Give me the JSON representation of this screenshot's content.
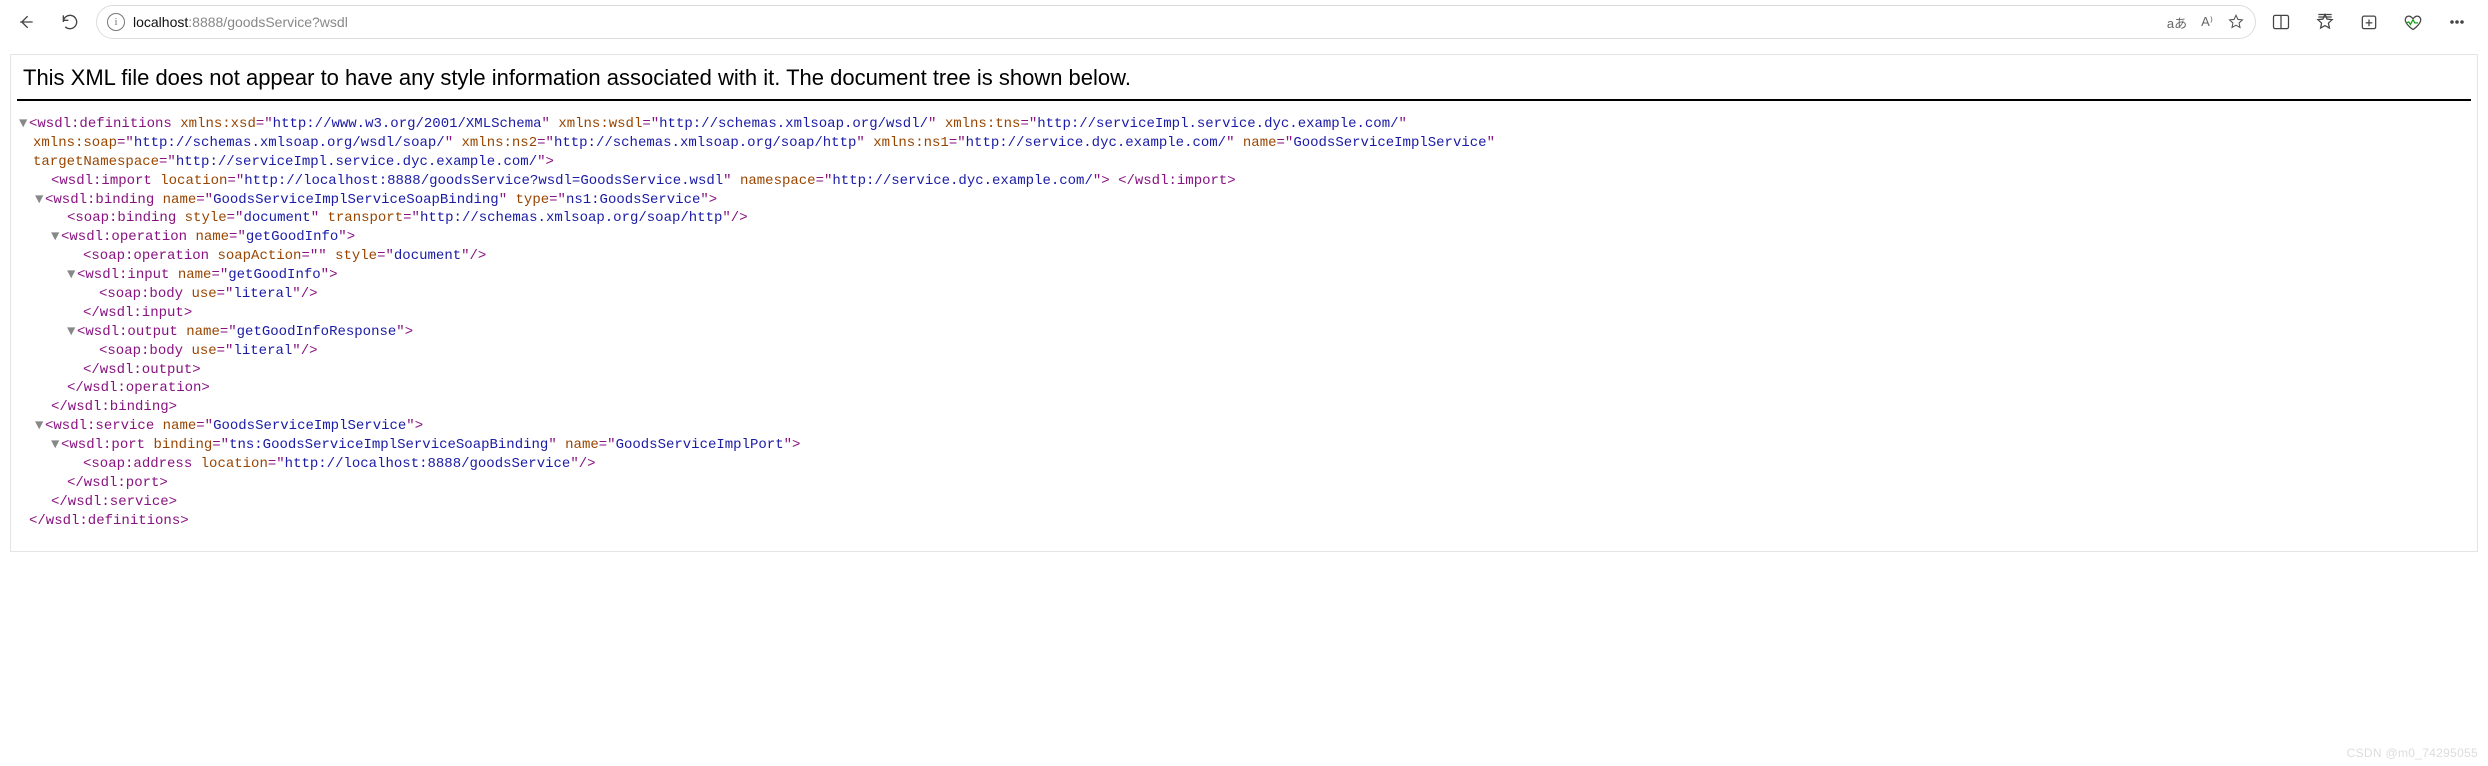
{
  "toolbar": {
    "back_title": "Back",
    "refresh_title": "Refresh"
  },
  "address": {
    "host": "localhost",
    "rest": ":8888/goodsService?wsdl",
    "translate_label": "aあ",
    "readaloud_label": "A⁾"
  },
  "banner": "This XML file does not appear to have any style information associated with it. The document tree is shown below.",
  "watermark": "CSDN @m0_74295055",
  "xml": {
    "definitions": {
      "tag_open": "wsdl:definitions",
      "attrs": [
        {
          "n": "xmlns:xsd",
          "v": "http://www.w3.org/2001/XMLSchema"
        },
        {
          "n": "xmlns:wsdl",
          "v": "http://schemas.xmlsoap.org/wsdl/"
        },
        {
          "n": "xmlns:tns",
          "v": "http://serviceImpl.service.dyc.example.com/"
        },
        {
          "n": "xmlns:soap",
          "v": "http://schemas.xmlsoap.org/wsdl/soap/"
        },
        {
          "n": "xmlns:ns2",
          "v": "http://schemas.xmlsoap.org/soap/http"
        },
        {
          "n": "xmlns:ns1",
          "v": "http://service.dyc.example.com/"
        },
        {
          "n": "name",
          "v": "GoodsServiceImplService"
        },
        {
          "n": "targetNamespace",
          "v": "http://serviceImpl.service.dyc.example.com/"
        }
      ],
      "import": {
        "tag": "wsdl:import",
        "location_n": "location",
        "location_v": "http://localhost:8888/goodsService?wsdl=GoodsService.wsdl",
        "namespace_n": "namespace",
        "namespace_v": "http://service.dyc.example.com/",
        "close": "</wsdl:import>"
      },
      "binding": {
        "tag": "wsdl:binding",
        "name_n": "name",
        "name_v": "GoodsServiceImplServiceSoapBinding",
        "type_n": "type",
        "type_v": "ns1:GoodsService",
        "soap_binding": {
          "tag": "soap:binding",
          "style_n": "style",
          "style_v": "document",
          "transport_n": "transport",
          "transport_v": "http://schemas.xmlsoap.org/soap/http"
        },
        "operation": {
          "tag": "wsdl:operation",
          "name_n": "name",
          "name_v": "getGoodInfo",
          "soap_operation": {
            "tag": "soap:operation",
            "soapAction_n": "soapAction",
            "soapAction_v": "",
            "style_n": "style",
            "style_v": "document"
          },
          "input": {
            "tag": "wsdl:input",
            "name_n": "name",
            "name_v": "getGoodInfo",
            "body": {
              "tag": "soap:body",
              "use_n": "use",
              "use_v": "literal"
            },
            "close": "</wsdl:input>"
          },
          "output": {
            "tag": "wsdl:output",
            "name_n": "name",
            "name_v": "getGoodInfoResponse",
            "body": {
              "tag": "soap:body",
              "use_n": "use",
              "use_v": "literal"
            },
            "close": "</wsdl:output>"
          },
          "close": "</wsdl:operation>"
        },
        "close": "</wsdl:binding>"
      },
      "service": {
        "tag": "wsdl:service",
        "name_n": "name",
        "name_v": "GoodsServiceImplService",
        "port": {
          "tag": "wsdl:port",
          "binding_n": "binding",
          "binding_v": "tns:GoodsServiceImplServiceSoapBinding",
          "name_n": "name",
          "name_v": "GoodsServiceImplPort",
          "address": {
            "tag": "soap:address",
            "location_n": "location",
            "location_v": "http://localhost:8888/goodsService"
          },
          "close": "</wsdl:port>"
        },
        "close": "</wsdl:service>"
      },
      "close": "</wsdl:definitions>"
    }
  }
}
